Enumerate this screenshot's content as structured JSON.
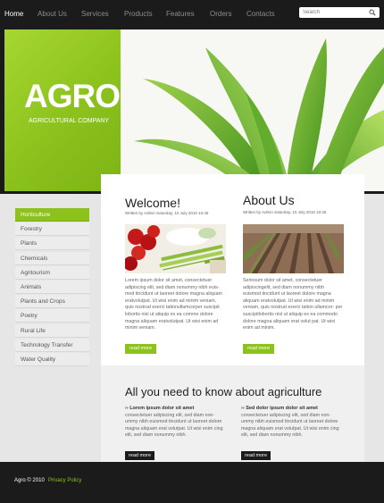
{
  "nav": {
    "items": [
      "Home",
      "About Us",
      "Services",
      "Products",
      "Features",
      "Orders",
      "Contacts"
    ],
    "active": "Home"
  },
  "search": {
    "placeholder": "Search"
  },
  "banner": {
    "logo": "AGRO",
    "tagline": "AGRICULTURAL COMPANY"
  },
  "sidebar": {
    "items": [
      "Horticulture",
      "Forestry",
      "Plants",
      "Chemicals",
      "Agritourism",
      "Animals",
      "Plants and Crops",
      "Poetry",
      "Rural Life",
      "Technology Transfer",
      "Water Quality"
    ],
    "active": "Horticulture"
  },
  "welcome": {
    "title": "Welcome!",
    "byline": "Written by Admin Saturday, 10 July 2010 10:45",
    "text": "Lorem ipsum dolor sit amet, consectetuer adipiscing elit, sed diam nonummy nibh euis- mod tincidunt ut laoreet dolore magna aliquam eratvolutpat. Ut wisi enim ad minim veniam, quis nostrud exerci tationullamcorper suscipit lobortis nisl ut aliquip ex ea commo dolore magna aliquam eratvolutpat. Ut wisi enim ad minim veniam.",
    "button": "read more"
  },
  "about": {
    "title": "About Us",
    "byline": "Written by Admin Saturday, 10 July 2010 10:45",
    "text": "Seriosum dolor sit amet, consectetuer adipiscingelit, sed diam nonummy nibh euismod tincidunt ut laoreet dolore magna aliquam eratvolutpat. Ut wisi enim ad minim veniam, quis nostrud exerci tation ullamcor- per suscipitlobortis nisl ut aliquip ex ea commodo dolore magna aliquam erat volut pat. Ut wisi enim ad minim.",
    "button": "read more"
  },
  "info": {
    "title": "All you need to know about agriculture",
    "left_head": "›› Lorem ipsum dolor sit amet",
    "left_text": "consectetuer adipiscing elit, sed diam non- ummy nibh euismod tincidunt ut laoreet dolore magna aliquam erat volutpat. Ut wisi enim cing elit, sed diam nonummy nibh.",
    "left_button": "read more",
    "right_head": "›› Sed dolor ipsum dolor sit amet",
    "right_text": "consectetuer adipiscing elit, sed diam non- ummy nibh euismod tincidunt ut laoreet dolore magna aliquam erat volutpat. Ut wisi enim cing elit, sed diam nonummy nibh.",
    "right_button": "read more"
  },
  "footer": {
    "copyright": "Agro © 2010",
    "privacy": "Privacy Policy"
  },
  "colors": {
    "accent": "#8cc21c",
    "dark": "#1b1b1b"
  }
}
